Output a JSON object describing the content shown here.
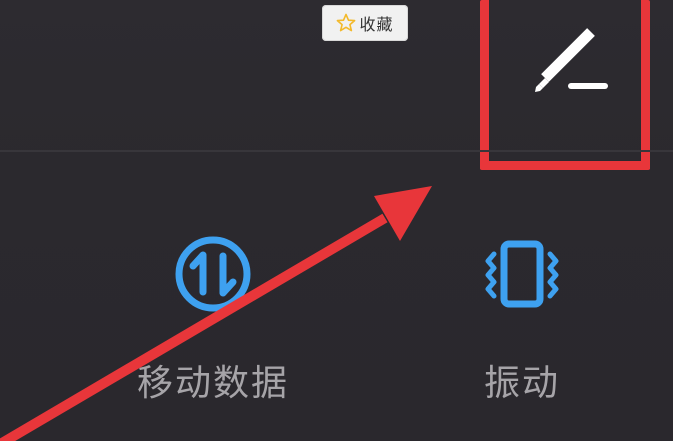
{
  "toolbar": {
    "favorite_label": "收藏",
    "edit_icon": "pencil-icon"
  },
  "quick_tiles": [
    {
      "label": "移动数据",
      "icon": "mobile-data-icon"
    },
    {
      "label": "振动",
      "icon": "vibration-icon"
    }
  ],
  "colors": {
    "panel_background": "#2b292e",
    "tile_icon": "#3ea1f0",
    "tile_label": "#a6a4a8",
    "annotation_red": "#e8363a",
    "chip_background": "#f1f1f1",
    "star": "#f3b92a"
  }
}
